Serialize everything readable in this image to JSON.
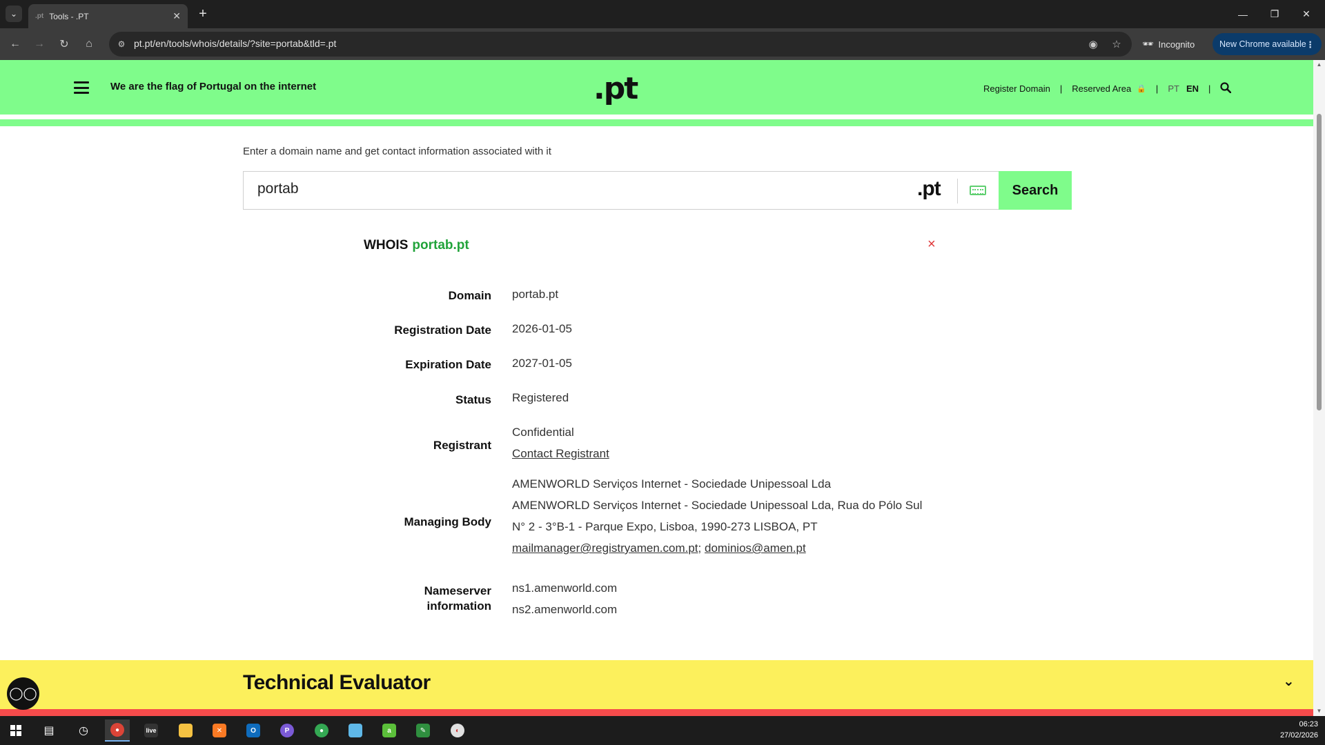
{
  "browser": {
    "tab_title": "Tools - .PT",
    "tab_favicon": ".pt",
    "url": "pt.pt/en/tools/whois/details/?site=portab&tld=.pt",
    "incognito_label": "Incognito",
    "new_chrome_label": "New Chrome available"
  },
  "header": {
    "tagline": "We are the flag of Portugal on the internet",
    "logo": ".pt",
    "register_domain": "Register Domain",
    "reserved_area": "Reserved Area",
    "lang_pt": "PT",
    "lang_en": "EN",
    "separator": "|"
  },
  "search": {
    "intro": "Enter a domain name and get contact information associated with it",
    "value": "portab",
    "tld": ".pt",
    "button": "Search"
  },
  "whois": {
    "title_prefix": "WHOIS",
    "domain": "portab.pt",
    "close": "×",
    "rows": {
      "domain_label": "Domain",
      "domain_value": "portab.pt",
      "reg_label": "Registration Date",
      "reg_value": "2026-01-05",
      "exp_label": "Expiration Date",
      "exp_value": "2027-01-05",
      "status_label": "Status",
      "status_value": "Registered",
      "registrant_label": "Registrant",
      "registrant_value": "Confidential",
      "registrant_link": "Contact Registrant",
      "managing_label": "Managing Body",
      "managing_line1": "AMENWORLD Serviços Internet - Sociedade Unipessoal Lda",
      "managing_line2": "AMENWORLD Serviços Internet - Sociedade Unipessoal Lda, Rua do Pólo Sul",
      "managing_line3": "N° 2 - 3°B-1 - Parque Expo, Lisboa, 1990-273 LISBOA, PT",
      "managing_email1": "mailmanager@registryamen.com.pt",
      "managing_email_sep": ";",
      "managing_email2": "dominios@amen.pt",
      "ns_label_1": "Nameserver",
      "ns_label_2": "information",
      "ns1": "ns1.amenworld.com",
      "ns2": "ns2.amenworld.com"
    }
  },
  "technical": {
    "title": "Technical Evaluator"
  },
  "taskbar": {
    "time": "06:23",
    "date": "27/02/2026"
  },
  "colors": {
    "brand_green": "#7ffc8b",
    "link_green": "#21a33a",
    "yellow": "#fcf05c",
    "red": "#f54b4b"
  }
}
